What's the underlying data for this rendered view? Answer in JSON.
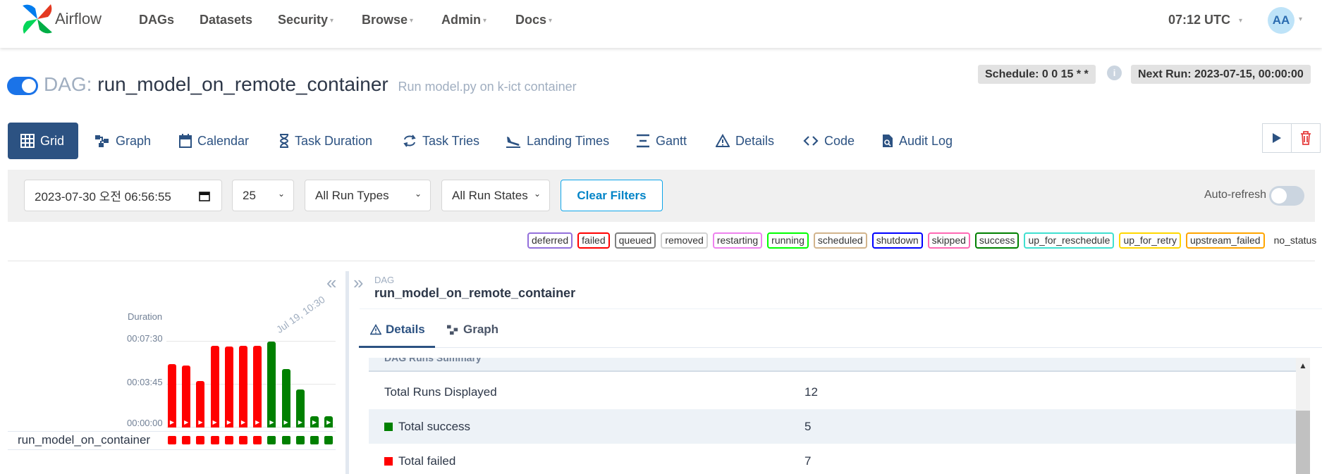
{
  "nav": {
    "brand": "Airflow",
    "items": [
      "DAGs",
      "Datasets",
      "Security",
      "Browse",
      "Admin",
      "Docs"
    ],
    "time": "07:12 UTC",
    "avatar": "AA"
  },
  "dag": {
    "prefix": "DAG:",
    "name": "run_model_on_remote_container",
    "description": "Run model.py on k-ict container",
    "schedule": "Schedule: 0 0 15 * *",
    "next_run": "Next Run: 2023-07-15, 00:00:00",
    "info_icon": "i",
    "paused_toggle": "on"
  },
  "tabs": [
    "Grid",
    "Graph",
    "Calendar",
    "Task Duration",
    "Task Tries",
    "Landing Times",
    "Gantt",
    "Details",
    "Code",
    "Audit Log"
  ],
  "actions": {
    "trigger_icon": "play-icon",
    "delete_icon": "trash-icon"
  },
  "filters": {
    "base_date": "2023-07-30 오전 06:56:55",
    "num_runs": "25",
    "run_type": "All Run Types",
    "run_state": "All Run States",
    "clear": "Clear Filters",
    "auto_refresh": "Auto-refresh"
  },
  "legend": [
    {
      "label": "deferred",
      "color": "#9370db"
    },
    {
      "label": "failed",
      "color": "#ff0000"
    },
    {
      "label": "queued",
      "color": "#808080"
    },
    {
      "label": "removed",
      "color": "#d3d3d3"
    },
    {
      "label": "restarting",
      "color": "#ee82ee"
    },
    {
      "label": "running",
      "color": "#00ff00"
    },
    {
      "label": "scheduled",
      "color": "#d2b48c"
    },
    {
      "label": "shutdown",
      "color": "#0000ff"
    },
    {
      "label": "skipped",
      "color": "#ff69b4"
    },
    {
      "label": "success",
      "color": "#008000"
    },
    {
      "label": "up_for_reschedule",
      "color": "#40e0d0"
    },
    {
      "label": "up_for_retry",
      "color": "#ffd700"
    },
    {
      "label": "upstream_failed",
      "color": "#ffa500"
    },
    {
      "label": "no_status",
      "color": ""
    }
  ],
  "grid": {
    "duration_label": "Duration",
    "y_ticks": [
      "00:07:30",
      "00:03:45",
      "00:00:00"
    ],
    "date_label": "Jul 19, 10:30",
    "task_name": "run_model_on_container",
    "collapse_left": "«",
    "collapse_right": "»"
  },
  "chart_data": {
    "type": "bar",
    "title": "",
    "ylabel": "Duration",
    "ylim_seconds": [
      0,
      450
    ],
    "y_tick_labels": [
      "00:00:00",
      "00:03:45",
      "00:07:30"
    ],
    "values_seconds": [
      332,
      324,
      243,
      427,
      424,
      427,
      427,
      449,
      305,
      198,
      45,
      45
    ],
    "run_states": [
      "failed",
      "failed",
      "failed",
      "failed",
      "failed",
      "failed",
      "failed",
      "success",
      "success",
      "success",
      "success",
      "success"
    ],
    "colors": {
      "failed": "#ff0000",
      "success": "#008000"
    }
  },
  "details": {
    "prefix": "DAG",
    "name": "run_model_on_remote_container",
    "tabs": [
      "Details",
      "Graph"
    ],
    "section_heading": "DAG Runs Summary",
    "rows": [
      {
        "label": "Total Runs Displayed",
        "value": "12",
        "swatch": ""
      },
      {
        "label": "Total success",
        "value": "5",
        "swatch": "#008000"
      },
      {
        "label": "Total failed",
        "value": "7",
        "swatch": "#ff0000"
      }
    ]
  }
}
